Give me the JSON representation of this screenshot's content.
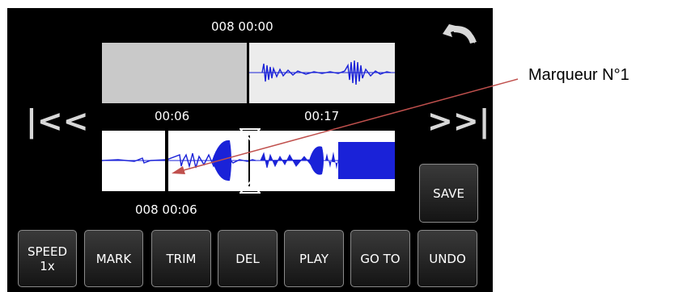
{
  "timeline": {
    "position_top": "008 00:00",
    "marker_left_time": "00:06",
    "marker_right_time": "00:17",
    "position_bottom": "008 00:06"
  },
  "nav": {
    "rewind_label": "|<<",
    "forward_label": ">>|"
  },
  "buttons": {
    "save": "SAVE",
    "speed_line1": "SPEED",
    "speed_line2": "1x",
    "mark": "MARK",
    "trim": "TRIM",
    "del": "DEL",
    "play": "PLAY",
    "goto": "GO TO",
    "undo": "UNDO"
  },
  "annotation": {
    "label": "Marqueur N°1"
  },
  "colors": {
    "waveform": "#1a22d8",
    "arrow": "#c0504d"
  }
}
